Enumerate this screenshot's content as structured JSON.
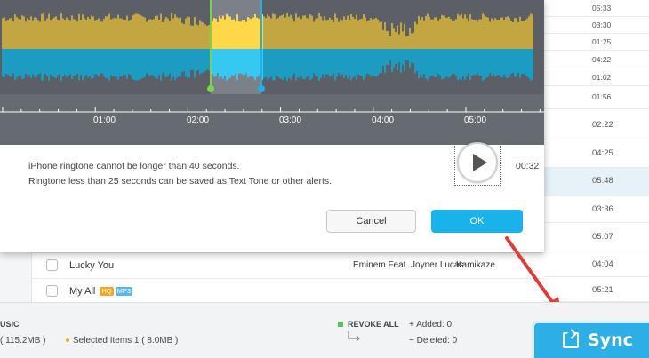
{
  "time_list": {
    "rows": [
      "05:33",
      "03:30",
      "01:25",
      "04:22",
      "01:02",
      "01:56",
      "02:22",
      "04:25",
      "05:48",
      "03:36",
      "05:07",
      "04:04",
      "05:21"
    ]
  },
  "songs": [
    {
      "name": "Lucky You",
      "artist": "Eminem Feat. Joyner Lucas",
      "album": "Kamikaze",
      "badges": []
    },
    {
      "name": "My All",
      "artist": "",
      "album": "",
      "badges": [
        "HQ",
        "MP3"
      ]
    }
  ],
  "dialog": {
    "timeline_ticks": [
      "01:00",
      "02:00",
      "03:00",
      "04:00",
      "05:00"
    ],
    "message_line1": "iPhone ringtone cannot be longer than 40 seconds.",
    "message_line2": "Ringtone less than 25 seconds can be saved as Text Tone or other alerts.",
    "duration": "00:32",
    "cancel_label": "Cancel",
    "ok_label": "OK",
    "play_icon": "play-icon",
    "colors": {
      "wave_top": "#c2a642",
      "wave_bottom": "#1b9cc0",
      "selection_top": "#ffd84a",
      "selection_bottom": "#36c8f0",
      "start_marker": "#7dd34a",
      "end_marker": "#1ab2ea"
    }
  },
  "bottom_bar": {
    "title": "USIC",
    "total_size": "( 115.2MB )",
    "selected": "Selected Items 1 ( 8.0MB )",
    "revoke_label": "REVOKE ALL",
    "added": "Added: 0",
    "deleted": "Deleted: 0",
    "sync_label": "Sync"
  }
}
